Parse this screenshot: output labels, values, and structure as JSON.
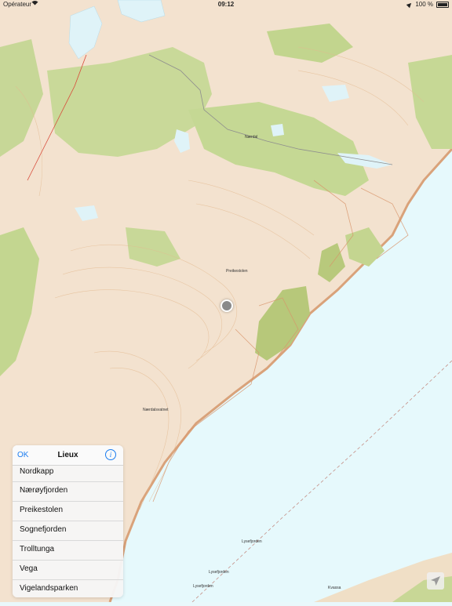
{
  "status_bar": {
    "carrier": "Opérateur",
    "time": "09:12",
    "battery": "100 %"
  },
  "map": {
    "labels": {
      "place_1": "Nærdal",
      "place_2": "Preikestolen",
      "place_3": "Nærdalsvatnet",
      "place_4": "Lysefjorden",
      "place_5": "Lysefjorden",
      "place_6": "Lysefjorden",
      "place_7": "Kvassa"
    }
  },
  "places_panel": {
    "ok_label": "OK",
    "title": "Lieux",
    "info_glyph": "i",
    "items": [
      {
        "label": "Nordkapp"
      },
      {
        "label": "Nærøyfjorden"
      },
      {
        "label": "Preikestolen"
      },
      {
        "label": "Sognefjorden"
      },
      {
        "label": "Trolltunga"
      },
      {
        "label": "Vega"
      },
      {
        "label": "Vigelandsparken"
      }
    ]
  }
}
